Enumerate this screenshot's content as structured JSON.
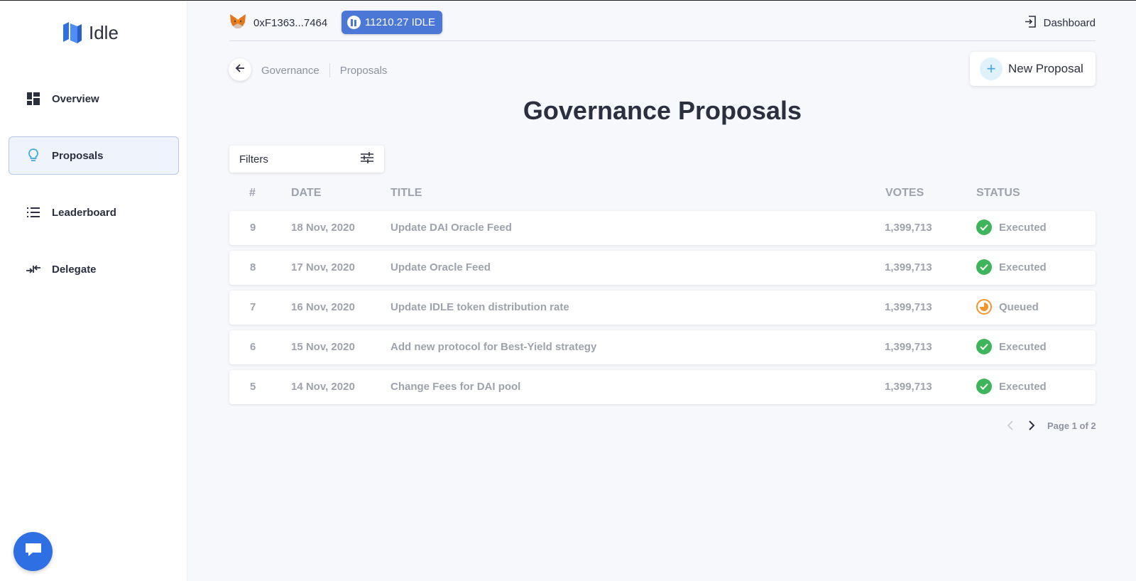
{
  "app": {
    "logo_text": "Idle"
  },
  "sidebar": {
    "items": [
      {
        "label": "Overview",
        "icon": "grid-icon"
      },
      {
        "label": "Proposals",
        "icon": "lightbulb-icon",
        "active": true
      },
      {
        "label": "Leaderboard",
        "icon": "list-icon"
      },
      {
        "label": "Delegate",
        "icon": "delegate-arrows-icon"
      }
    ]
  },
  "header": {
    "wallet_address": "0xF1363...7464",
    "balance": "11210.27 IDLE",
    "dashboard_label": "Dashboard"
  },
  "breadcrumb": {
    "parent": "Governance",
    "current": "Proposals"
  },
  "actions": {
    "new_proposal_label": "New Proposal"
  },
  "page": {
    "title": "Governance Proposals"
  },
  "filters": {
    "label": "Filters"
  },
  "table": {
    "columns": {
      "num": "#",
      "date": "DATE",
      "title": "TITLE",
      "votes": "VOTES",
      "status": "STATUS"
    },
    "rows": [
      {
        "num": "9",
        "date": "18 Nov, 2020",
        "title": "Update DAI Oracle Feed",
        "votes": "1,399,713",
        "status": "Executed",
        "state": "executed"
      },
      {
        "num": "8",
        "date": "17 Nov, 2020",
        "title": "Update Oracle Feed",
        "votes": "1,399,713",
        "status": "Executed",
        "state": "executed"
      },
      {
        "num": "7",
        "date": "16 Nov, 2020",
        "title": "Update IDLE token distribution rate",
        "votes": "1,399,713",
        "status": "Queued",
        "state": "queued"
      },
      {
        "num": "6",
        "date": "15 Nov, 2020",
        "title": "Add new protocol for Best-Yield strategy",
        "votes": "1,399,713",
        "status": "Executed",
        "state": "executed"
      },
      {
        "num": "5",
        "date": "14 Nov, 2020",
        "title": "Change Fees for DAI pool",
        "votes": "1,399,713",
        "status": "Executed",
        "state": "executed"
      }
    ]
  },
  "pagination": {
    "label": "Page 1 of 2"
  },
  "colors": {
    "accent": "#2f6fe4",
    "executed": "#3fb45a",
    "queued": "#f0962c",
    "badge": "#4b78d6"
  }
}
